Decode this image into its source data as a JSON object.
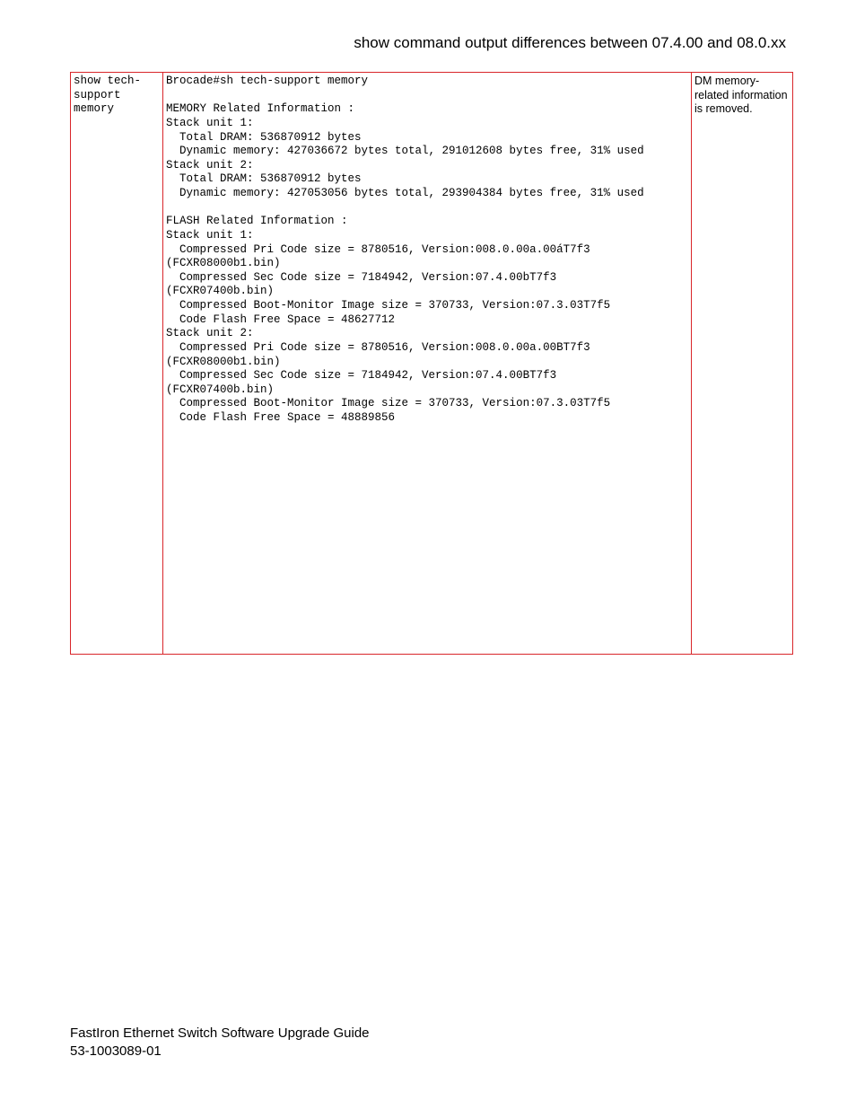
{
  "header": {
    "title": "show command output differences between 07.4.00 and 08.0.xx"
  },
  "table": {
    "command": "show tech-\nsupport\nmemory",
    "output": "Brocade#sh tech-support memory\n\nMEMORY Related Information :\nStack unit 1:\n  Total DRAM: 536870912 bytes\n  Dynamic memory: 427036672 bytes total, 291012608 bytes free, 31% used\nStack unit 2:\n  Total DRAM: 536870912 bytes\n  Dynamic memory: 427053056 bytes total, 293904384 bytes free, 31% used\n\nFLASH Related Information :\nStack unit 1:\n  Compressed Pri Code size = 8780516, Version:008.0.00a.00áT7f3\n(FCXR08000b1.bin)\n  Compressed Sec Code size = 7184942, Version:07.4.00bT7f3\n(FCXR07400b.bin)\n  Compressed Boot-Monitor Image size = 370733, Version:07.3.03T7f5\n  Code Flash Free Space = 48627712\nStack unit 2:\n  Compressed Pri Code size = 8780516, Version:008.0.00a.00BT7f3\n(FCXR08000b1.bin)\n  Compressed Sec Code size = 7184942, Version:07.4.00BT7f3\n(FCXR07400b.bin)\n  Compressed Boot-Monitor Image size = 370733, Version:07.3.03T7f5\n  Code Flash Free Space = 48889856\n\n\n\n\n\n\n\n\n\n\n\n\n\n\n\n\n",
    "note": "DM memory-related information is removed."
  },
  "footer": {
    "line1": "FastIron Ethernet Switch Software Upgrade Guide",
    "line2": "53-1003089-01"
  }
}
